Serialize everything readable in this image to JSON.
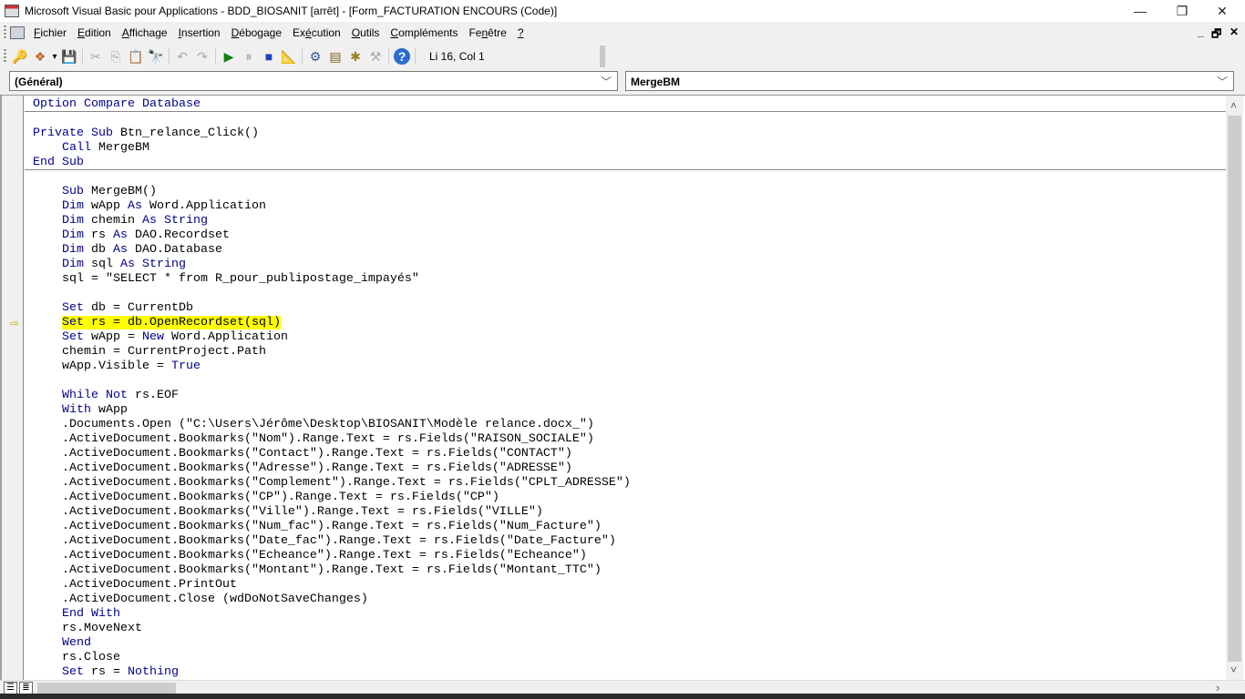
{
  "window": {
    "title": "Microsoft Visual Basic pour Applications - BDD_BIOSANIT [arrêt] - [Form_FACTURATION ENCOURS (Code)]",
    "controls": {
      "minimize": "—",
      "restore": "❐",
      "close": "✕"
    }
  },
  "menu": {
    "items": [
      {
        "label": "Fichier",
        "u": "F",
        "rest": "ichier"
      },
      {
        "label": "Edition",
        "u": "E",
        "rest": "dition"
      },
      {
        "label": "Affichage",
        "u": "A",
        "rest": "ffichage"
      },
      {
        "label": "Insertion",
        "u": "I",
        "rest": "nsertion"
      },
      {
        "label": "Débogage",
        "u": "D",
        "rest": "ébogage"
      },
      {
        "label": "Exécution",
        "pre": "Ex",
        "u": "é",
        "rest": "cution"
      },
      {
        "label": "Outils",
        "u": "O",
        "rest": "utils"
      },
      {
        "label": "Compléments",
        "u": "C",
        "rest": "ompléments"
      },
      {
        "label": "Fenêtre",
        "pre": "Fe",
        "u": "n",
        "rest": "être"
      },
      {
        "label": "?",
        "u": "?",
        "rest": ""
      }
    ],
    "mdi": {
      "minimize": "_",
      "restore": "🗗",
      "close": "✕"
    }
  },
  "toolbar": {
    "buttons": [
      {
        "name": "access-icon",
        "glyph": "🔑",
        "color": "#8b0000"
      },
      {
        "name": "insert-object-icon",
        "glyph": "❖",
        "color": "#c06020"
      },
      {
        "name": "dropdown-arrow-icon",
        "glyph": "▾",
        "color": "#000"
      },
      {
        "name": "save-icon",
        "glyph": "💾",
        "color": "#2040a0"
      },
      {
        "sep": true
      },
      {
        "name": "cut-icon",
        "glyph": "✂",
        "color": "#aaa"
      },
      {
        "name": "copy-icon",
        "glyph": "⎘",
        "color": "#aaa"
      },
      {
        "name": "paste-icon",
        "glyph": "📋",
        "color": "#b08020"
      },
      {
        "name": "find-icon",
        "glyph": "🔭",
        "color": "#203070"
      },
      {
        "sep": true
      },
      {
        "name": "undo-icon",
        "glyph": "↶",
        "color": "#aaa"
      },
      {
        "name": "redo-icon",
        "glyph": "↷",
        "color": "#aaa"
      },
      {
        "sep": true
      },
      {
        "name": "run-icon",
        "glyph": "▶",
        "color": "#108010"
      },
      {
        "name": "pause-icon",
        "glyph": "⏸",
        "color": "#aaa"
      },
      {
        "name": "stop-icon",
        "glyph": "■",
        "color": "#2040c0"
      },
      {
        "name": "design-mode-icon",
        "glyph": "📐",
        "color": "#204080"
      },
      {
        "sep": true
      },
      {
        "name": "project-explorer-icon",
        "glyph": "⚙",
        "color": "#3050a0"
      },
      {
        "name": "properties-icon",
        "glyph": "▤",
        "color": "#806020"
      },
      {
        "name": "object-browser-icon",
        "glyph": "✱",
        "color": "#a08020"
      },
      {
        "name": "toolbox-icon",
        "glyph": "⚒",
        "color": "#aaa"
      },
      {
        "sep": true
      },
      {
        "name": "help-icon",
        "glyph": "?",
        "color": "#fff",
        "bg": "#2a6cd0"
      }
    ],
    "status": "Li 16, Col 1"
  },
  "combos": {
    "object": "(Général)",
    "procedure": "MergeBM",
    "chevron": "﹀"
  },
  "code": {
    "current_line": 15,
    "arrow": "⇨",
    "separators_after": [
      0,
      4
    ],
    "lines": [
      [
        [
          "Option Compare Database",
          1
        ]
      ],
      [
        [
          "",
          0
        ]
      ],
      [
        [
          "Private Sub",
          1
        ],
        [
          " Btn_relance_Click()",
          0
        ]
      ],
      [
        [
          "    ",
          0
        ],
        [
          "Call",
          1
        ],
        [
          " MergeBM",
          0
        ]
      ],
      [
        [
          "End Sub",
          1
        ]
      ],
      [
        [
          "",
          0
        ]
      ],
      [
        [
          "    ",
          0
        ],
        [
          "Sub",
          1
        ],
        [
          " MergeBM()",
          0
        ]
      ],
      [
        [
          "    ",
          0
        ],
        [
          "Dim",
          1
        ],
        [
          " wApp ",
          0
        ],
        [
          "As",
          1
        ],
        [
          " Word.Application",
          0
        ]
      ],
      [
        [
          "    ",
          0
        ],
        [
          "Dim",
          1
        ],
        [
          " chemin ",
          0
        ],
        [
          "As String",
          1
        ]
      ],
      [
        [
          "    ",
          0
        ],
        [
          "Dim",
          1
        ],
        [
          " rs ",
          0
        ],
        [
          "As",
          1
        ],
        [
          " DAO.Recordset",
          0
        ]
      ],
      [
        [
          "    ",
          0
        ],
        [
          "Dim",
          1
        ],
        [
          " db ",
          0
        ],
        [
          "As",
          1
        ],
        [
          " DAO.Database",
          0
        ]
      ],
      [
        [
          "    ",
          0
        ],
        [
          "Dim",
          1
        ],
        [
          " sql ",
          0
        ],
        [
          "As String",
          1
        ]
      ],
      [
        [
          "    sql = \"SELECT * from R_pour_publipostage_impayés\"",
          0
        ]
      ],
      [
        [
          "",
          0
        ]
      ],
      [
        [
          "    ",
          0
        ],
        [
          "Set",
          1
        ],
        [
          " db = CurrentDb",
          0
        ]
      ],
      [
        [
          "    ",
          0
        ],
        [
          "Set",
          1
        ],
        [
          " rs = db.OpenRecordset(sql)",
          0
        ]
      ],
      [
        [
          "    ",
          0
        ],
        [
          "Set",
          1
        ],
        [
          " wApp = ",
          0
        ],
        [
          "New",
          1
        ],
        [
          " Word.Application",
          0
        ]
      ],
      [
        [
          "    chemin = CurrentProject.Path",
          0
        ]
      ],
      [
        [
          "    wApp.Visible = ",
          0
        ],
        [
          "True",
          1
        ]
      ],
      [
        [
          "",
          0
        ]
      ],
      [
        [
          "    ",
          0
        ],
        [
          "While Not",
          1
        ],
        [
          " rs.EOF",
          0
        ]
      ],
      [
        [
          "    ",
          0
        ],
        [
          "With",
          1
        ],
        [
          " wApp",
          0
        ]
      ],
      [
        [
          "    .Documents.Open (\"C:\\Users\\Jérôme\\Desktop\\BIOSANIT\\Modèle relance.docx_\")",
          0
        ]
      ],
      [
        [
          "    .ActiveDocument.Bookmarks(\"Nom\").Range.Text = rs.Fields(\"RAISON_SOCIALE\")",
          0
        ]
      ],
      [
        [
          "    .ActiveDocument.Bookmarks(\"Contact\").Range.Text = rs.Fields(\"CONTACT\")",
          0
        ]
      ],
      [
        [
          "    .ActiveDocument.Bookmarks(\"Adresse\").Range.Text = rs.Fields(\"ADRESSE\")",
          0
        ]
      ],
      [
        [
          "    .ActiveDocument.Bookmarks(\"Complement\").Range.Text = rs.Fields(\"CPLT_ADRESSE\")",
          0
        ]
      ],
      [
        [
          "    .ActiveDocument.Bookmarks(\"CP\").Range.Text = rs.Fields(\"CP\")",
          0
        ]
      ],
      [
        [
          "    .ActiveDocument.Bookmarks(\"Ville\").Range.Text = rs.Fields(\"VILLE\")",
          0
        ]
      ],
      [
        [
          "    .ActiveDocument.Bookmarks(\"Num_fac\").Range.Text = rs.Fields(\"Num_Facture\")",
          0
        ]
      ],
      [
        [
          "    .ActiveDocument.Bookmarks(\"Date_fac\").Range.Text = rs.Fields(\"Date_Facture\")",
          0
        ]
      ],
      [
        [
          "    .ActiveDocument.Bookmarks(\"Echeance\").Range.Text = rs.Fields(\"Echeance\")",
          0
        ]
      ],
      [
        [
          "    .ActiveDocument.Bookmarks(\"Montant\").Range.Text = rs.Fields(\"Montant_TTC\")",
          0
        ]
      ],
      [
        [
          "    .ActiveDocument.PrintOut",
          0
        ]
      ],
      [
        [
          "    .ActiveDocument.Close (wdDoNotSaveChanges)",
          0
        ]
      ],
      [
        [
          "    ",
          0
        ],
        [
          "End With",
          1
        ]
      ],
      [
        [
          "    rs.MoveNext",
          0
        ]
      ],
      [
        [
          "    ",
          0
        ],
        [
          "Wend",
          1
        ]
      ],
      [
        [
          "    rs.Close",
          0
        ]
      ],
      [
        [
          "    ",
          0
        ],
        [
          "Set",
          1
        ],
        [
          " rs = ",
          0
        ],
        [
          "Nothing",
          1
        ]
      ]
    ]
  },
  "scroll": {
    "up": "˄",
    "down": "˅",
    "left": "‹",
    "right": "›",
    "procedure_view": "☰",
    "module_view": "≣"
  },
  "colors": {
    "keyword": "#00008b",
    "highlight": "#ffff00",
    "arrow": "#c8b400"
  }
}
